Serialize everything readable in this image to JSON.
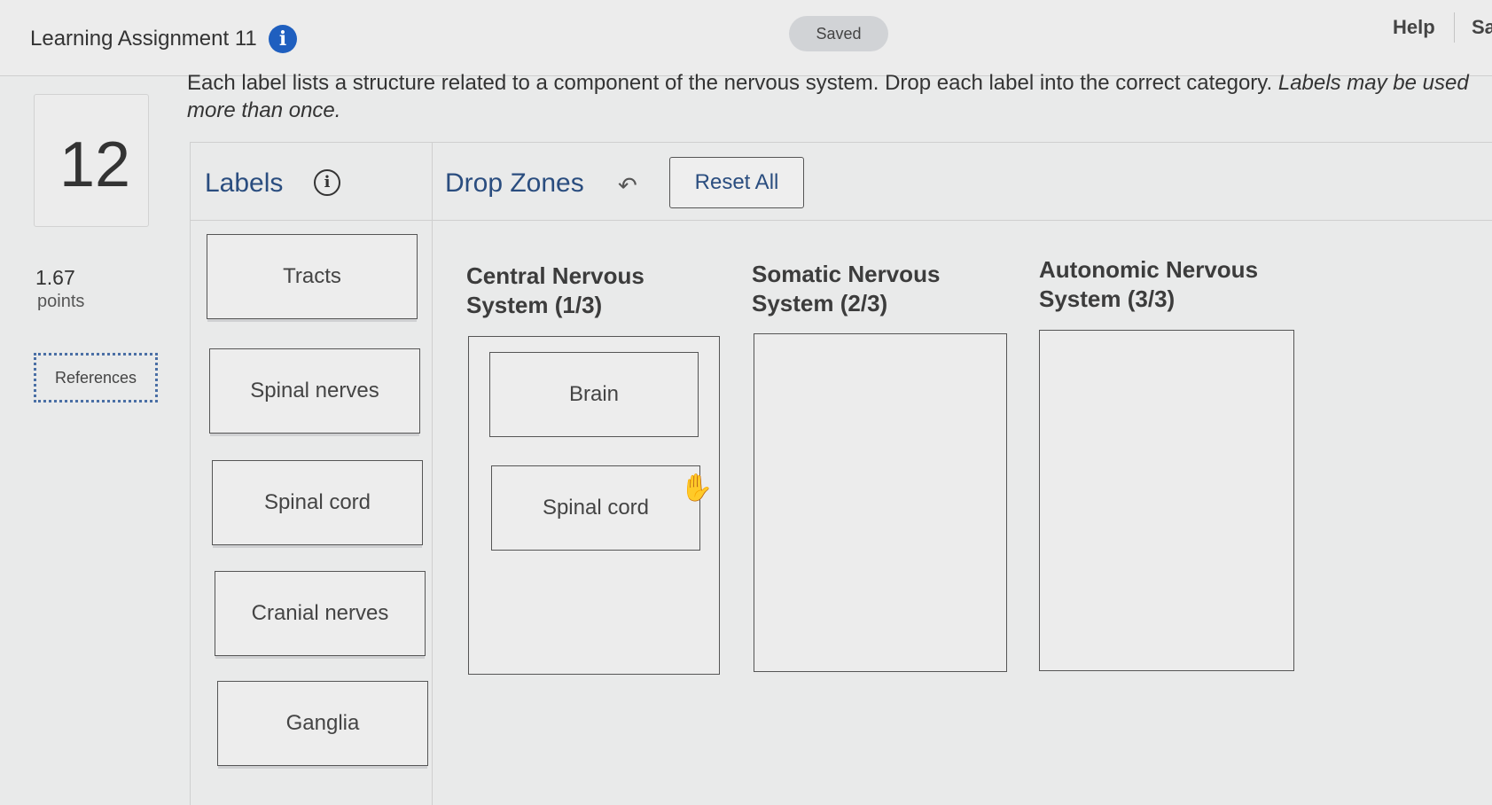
{
  "topbar": {
    "title": "Learning Assignment 11",
    "info_icon": "info-circle-icon",
    "saved": "Saved",
    "help": "Help",
    "save_exit": "Save & Exit"
  },
  "question": {
    "number": "12",
    "points_value": "1.67",
    "points_label": "points",
    "references": "References",
    "instructions": "Each label lists a structure related to a component of the nervous system. Drop each label into the correct category.",
    "instructions_italic": "Labels may be used more than once."
  },
  "labels_panel": {
    "heading": "Labels",
    "info_icon": "info-circle-icon",
    "items": [
      "Tracts",
      "Spinal nerves",
      "Spinal cord",
      "Cranial nerves",
      "Ganglia"
    ]
  },
  "drop_panel": {
    "heading": "Drop Zones",
    "undo_icon": "undo-arrow-icon",
    "reset": "Reset All",
    "zones": [
      {
        "title": "Central Nervous System (1/3)",
        "placed": [
          "Brain",
          "Spinal cord"
        ]
      },
      {
        "title": "Somatic Nervous System (2/3)",
        "placed": []
      },
      {
        "title": "Autonomic Nervous System (3/3)",
        "placed": []
      }
    ]
  },
  "cursor": "hand-pointer-icon",
  "colors": {
    "accent_blue": "#1f5fbf",
    "heading_blue": "#2a4d7f",
    "background": "#e9eaea"
  }
}
